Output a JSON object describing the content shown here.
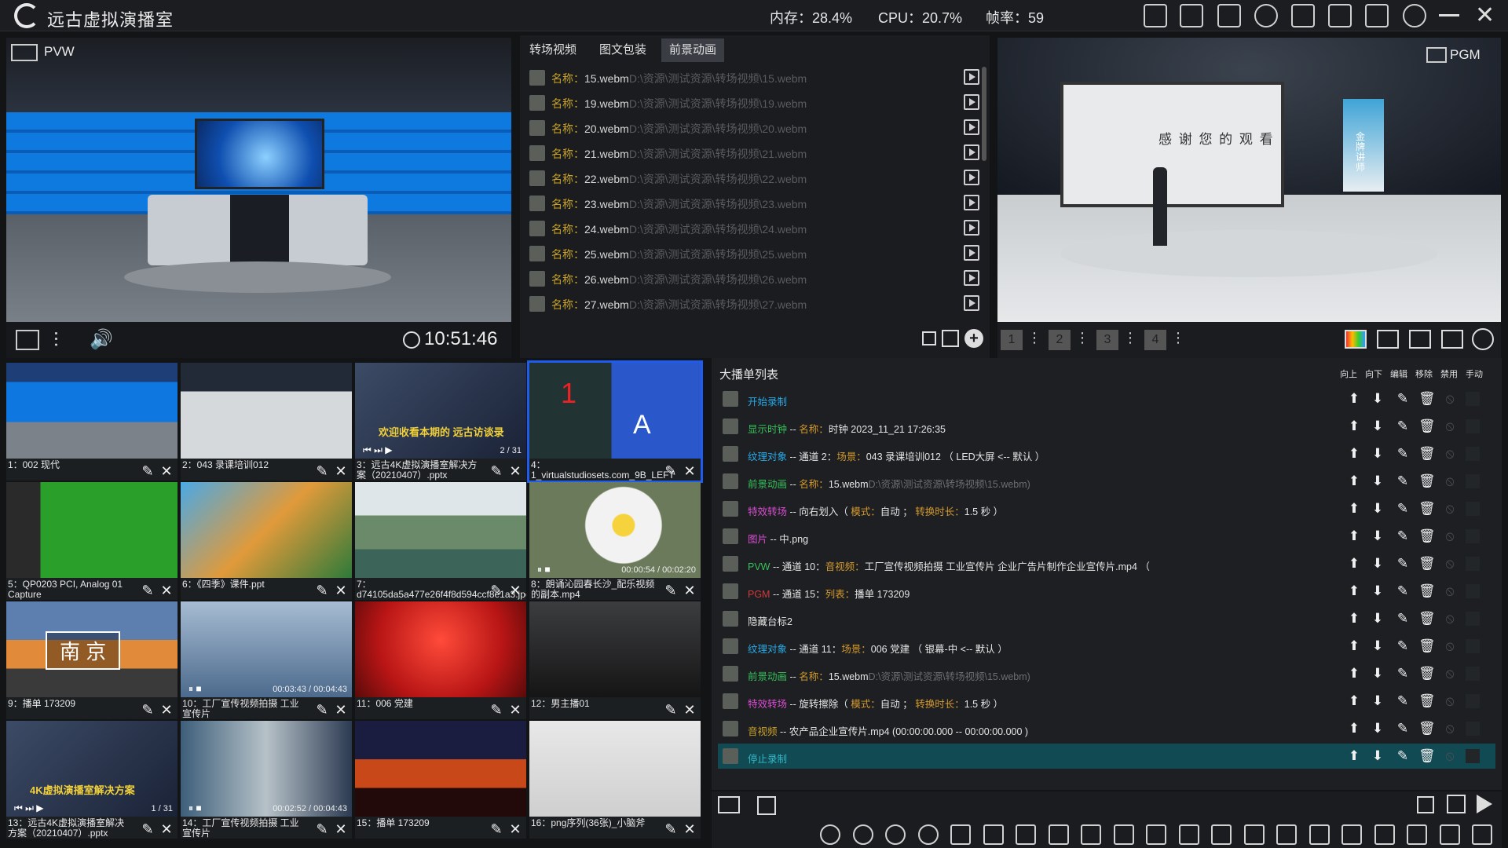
{
  "app": {
    "title": "远古虚拟演播室"
  },
  "status": {
    "memory": "内存：28.4%",
    "cpu": "CPU：20.7%",
    "fps": "帧率：59"
  },
  "toolbar_icons": [
    "calendar-icon",
    "layout-icon",
    "monitor-icon",
    "cloud-download-icon",
    "shirt-icon",
    "folder-icon",
    "save-icon",
    "gear-icon",
    "minimize-icon",
    "close-icon"
  ],
  "pvw": {
    "label": "PVW",
    "clock": "10:51:46"
  },
  "pgm": {
    "label": "PGM",
    "screen_text": "感 谢 您 的 观 看",
    "banner_text": "金牌讲师",
    "scenes": [
      "1",
      "2",
      "3",
      "4"
    ]
  },
  "tabs": [
    {
      "label": "转场视频"
    },
    {
      "label": "图文包装"
    },
    {
      "label": "前景动画"
    }
  ],
  "effects": [
    {
      "key": "名称：",
      "name": "15.webm",
      "path": "D:\\资源\\测试资源\\转场视频\\15.webm"
    },
    {
      "key": "名称：",
      "name": "19.webm",
      "path": "D:\\资源\\测试资源\\转场视频\\19.webm"
    },
    {
      "key": "名称：",
      "name": "20.webm",
      "path": "D:\\资源\\测试资源\\转场视频\\20.webm"
    },
    {
      "key": "名称：",
      "name": "21.webm",
      "path": "D:\\资源\\测试资源\\转场视频\\21.webm"
    },
    {
      "key": "名称：",
      "name": "22.webm",
      "path": "D:\\资源\\测试资源\\转场视频\\22.webm"
    },
    {
      "key": "名称：",
      "name": "23.webm",
      "path": "D:\\资源\\测试资源\\转场视频\\23.webm"
    },
    {
      "key": "名称：",
      "name": "24.webm",
      "path": "D:\\资源\\测试资源\\转场视频\\24.webm"
    },
    {
      "key": "名称：",
      "name": "25.webm",
      "path": "D:\\资源\\测试资源\\转场视频\\25.webm"
    },
    {
      "key": "名称：",
      "name": "26.webm",
      "path": "D:\\资源\\测试资源\\转场视频\\26.webm"
    },
    {
      "key": "名称：",
      "name": "27.webm",
      "path": "D:\\资源\\测试资源\\转场视频\\27.webm"
    }
  ],
  "thumbs": [
    {
      "caption": "1：002 现代",
      "overlay": ""
    },
    {
      "caption": "2：043 录课培训012",
      "overlay": ""
    },
    {
      "caption": "3：远古4K虚拟演播室解决方案（20210407）.pptx",
      "overlay": "欢迎收看本期的 远古访谈录",
      "counter": "2 / 31"
    },
    {
      "caption": "4：1_virtualstudiosets.com_9B_LEFT",
      "overlay": "1",
      "overlay2": "A"
    },
    {
      "caption": "5：QP0203 PCI, Analog 01 Capture",
      "overlay": ""
    },
    {
      "caption": "6：《四季》课件.ppt",
      "overlay": ""
    },
    {
      "caption": "7：d74105da5a477e26f4f8d594ccf8e1a3.jpeg",
      "overlay": ""
    },
    {
      "caption": "8：朗诵沁园春长沙_配乐视频的副本.mp4",
      "overlay": "",
      "time": "00:00:54 / 00:02:20"
    },
    {
      "caption": "9：播单 173209",
      "overlay": "南 京"
    },
    {
      "caption": "10：工厂宣传视频拍摄 工业宣传片",
      "overlay": "",
      "time": "00:03:43 / 00:04:43"
    },
    {
      "caption": "11：006 党建",
      "overlay": ""
    },
    {
      "caption": "12：男主播01",
      "overlay": ""
    },
    {
      "caption": "13：远古4K虚拟演播室解决方案（20210407）.pptx",
      "overlay": "4K虚拟演播室解决方案",
      "counter": "1 / 31"
    },
    {
      "caption": "14：工厂宣传视频拍摄 工业宣传片",
      "overlay": "",
      "time": "00:02:52 / 00:04:43"
    },
    {
      "caption": "15：播单 173209",
      "overlay": ""
    },
    {
      "caption": "16：png序列(36张)_小脑斧",
      "overlay": ""
    }
  ],
  "playlist": {
    "title": "大播单列表",
    "headers": [
      "向上",
      "向下",
      "编辑",
      "移除",
      "禁用",
      "手动"
    ],
    "rows": [
      {
        "parts": [
          {
            "t": "开始录制",
            "c": "b"
          }
        ]
      },
      {
        "parts": [
          {
            "t": "显示时钟",
            "c": "g"
          },
          {
            "t": " -- ",
            "c": ""
          },
          {
            "t": "名称：",
            "c": "o"
          },
          {
            "t": "时钟 2023_11_21 17:26:35",
            "c": ""
          }
        ]
      },
      {
        "parts": [
          {
            "t": "纹理对象",
            "c": "b"
          },
          {
            "t": " -- 通道 2：",
            "c": ""
          },
          {
            "t": "场景：",
            "c": "o"
          },
          {
            "t": "043 录课培训012 （ LED大屏 <-- 默认 ）",
            "c": ""
          }
        ]
      },
      {
        "parts": [
          {
            "t": "前景动画",
            "c": "g"
          },
          {
            "t": " -- ",
            "c": ""
          },
          {
            "t": "名称：",
            "c": "o"
          },
          {
            "t": "15.webm",
            "c": ""
          },
          {
            "t": "D:\\资源\\测试资源\\转场视频\\15.webm)",
            "c": "p"
          }
        ]
      },
      {
        "parts": [
          {
            "t": "特效转场",
            "c": "m"
          },
          {
            "t": " -- 向右划入（ ",
            "c": ""
          },
          {
            "t": "模式：",
            "c": "o"
          },
          {
            "t": "自动 ； ",
            "c": ""
          },
          {
            "t": "转换时长：",
            "c": "o"
          },
          {
            "t": "1.5 秒 ）",
            "c": ""
          }
        ]
      },
      {
        "parts": [
          {
            "t": "图片",
            "c": "m"
          },
          {
            "t": " -- 中.png",
            "c": ""
          }
        ]
      },
      {
        "parts": [
          {
            "t": "PVW",
            "c": "g"
          },
          {
            "t": " -- 通道 10：",
            "c": ""
          },
          {
            "t": "音视频：",
            "c": "o"
          },
          {
            "t": "工厂宣传视频拍摄 工业宣传片 企业广告片制作企业宣传片.mp4 （",
            "c": ""
          }
        ]
      },
      {
        "parts": [
          {
            "t": "PGM",
            "c": "r"
          },
          {
            "t": " -- 通道 15：",
            "c": ""
          },
          {
            "t": "列表：",
            "c": "o"
          },
          {
            "t": "播单 173209",
            "c": ""
          }
        ]
      },
      {
        "parts": [
          {
            "t": "隐藏台标2",
            "c": ""
          }
        ]
      },
      {
        "parts": [
          {
            "t": "纹理对象",
            "c": "b"
          },
          {
            "t": " -- 通道 11：",
            "c": ""
          },
          {
            "t": "场景：",
            "c": "o"
          },
          {
            "t": "006 党建 （ 银幕-中 <-- 默认 ）",
            "c": ""
          }
        ]
      },
      {
        "parts": [
          {
            "t": "前景动画",
            "c": "g"
          },
          {
            "t": " -- ",
            "c": ""
          },
          {
            "t": "名称：",
            "c": "o"
          },
          {
            "t": "15.webm",
            "c": ""
          },
          {
            "t": "D:\\资源\\测试资源\\转场视频\\15.webm)",
            "c": "p"
          }
        ]
      },
      {
        "parts": [
          {
            "t": "特效转场",
            "c": "m"
          },
          {
            "t": " -- 旋转擦除（ ",
            "c": ""
          },
          {
            "t": "模式：",
            "c": "o"
          },
          {
            "t": "自动 ； ",
            "c": ""
          },
          {
            "t": "转换时长：",
            "c": "o"
          },
          {
            "t": "1.5 秒 ）",
            "c": ""
          }
        ]
      },
      {
        "parts": [
          {
            "t": "音视频",
            "c": "y"
          },
          {
            "t": " -- 农产品企业宣传片.mp4 (00:00:00.000 -- 00:00:00.000 )",
            "c": ""
          }
        ]
      },
      {
        "parts": [
          {
            "t": "停止录制",
            "c": "c"
          }
        ],
        "selected": true
      }
    ]
  },
  "colors": {
    "accent": "#1e5cf0",
    "selected_row": "#124a54"
  }
}
